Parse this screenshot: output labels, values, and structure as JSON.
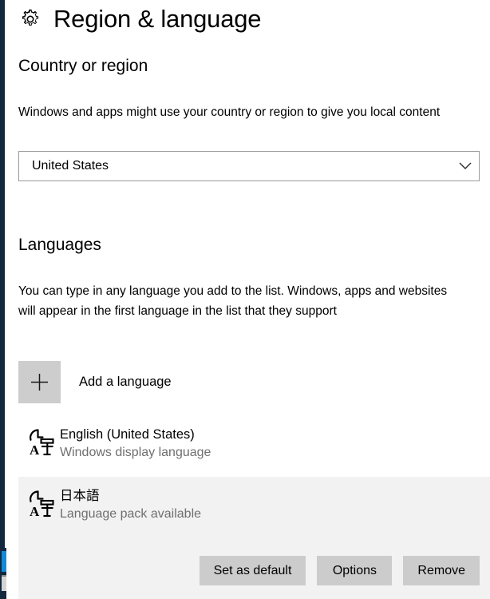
{
  "window": {
    "accent_edge_color": "#12283f",
    "surface_color": "#ffffff"
  },
  "header": {
    "icon": "gear-icon",
    "title": "Region & language"
  },
  "country_section": {
    "heading": "Country or region",
    "description": "Windows and apps might use your country or region to give you local content",
    "dropdown": {
      "selected_value": "United States",
      "chevron_icon": "chevron-down-icon"
    }
  },
  "languages_section": {
    "heading": "Languages",
    "description": "You can type in any language you add to the list. Windows, apps and websites will appear in the first language in the list that they support",
    "add_language": {
      "icon": "plus-icon",
      "label": "Add a language"
    },
    "items": [
      {
        "icon": "language-glyph-icon",
        "name": "English (United States)",
        "status": "Windows display language",
        "selected": false
      },
      {
        "icon": "language-glyph-icon",
        "name": "日本語",
        "status": "Language pack available",
        "selected": true
      }
    ],
    "actions": [
      {
        "label": "Set as default",
        "name": "set-as-default-button"
      },
      {
        "label": "Options",
        "name": "options-button"
      },
      {
        "label": "Remove",
        "name": "remove-button"
      }
    ],
    "selected_row_color": "#f2f2f2",
    "button_color": "#cccccc"
  }
}
